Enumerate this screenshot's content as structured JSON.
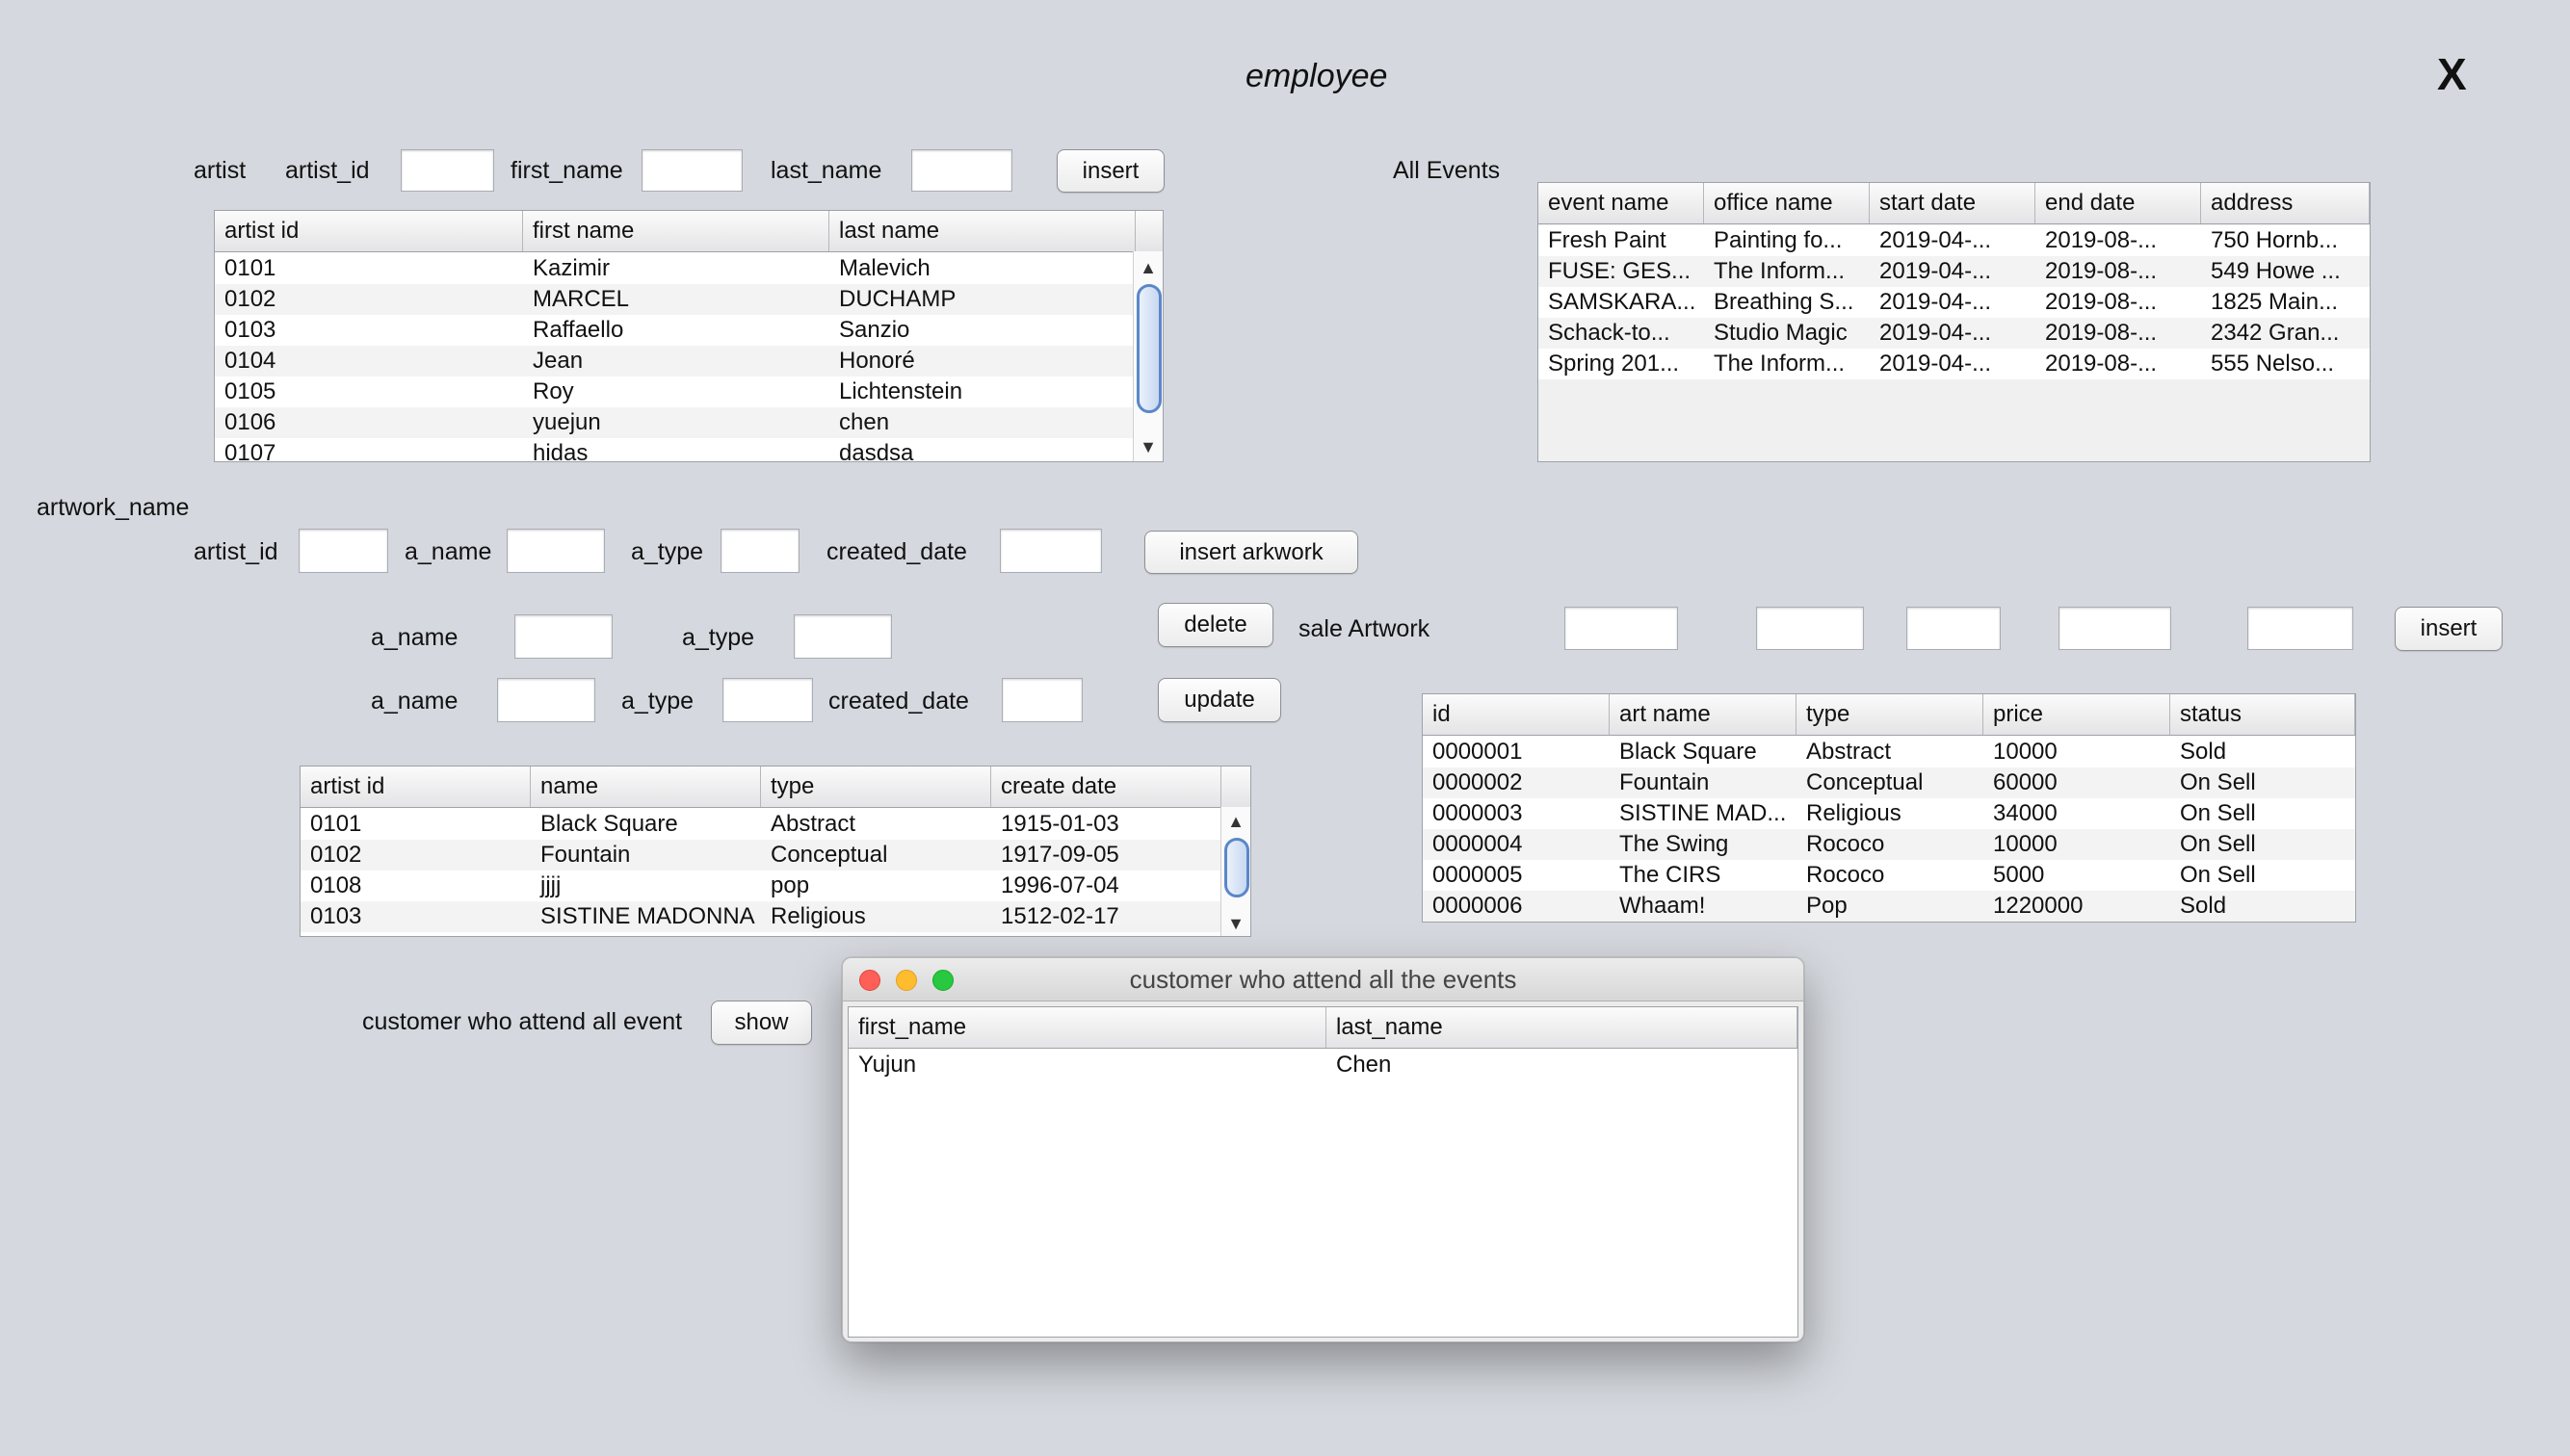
{
  "window": {
    "title": "employee",
    "close_label": "X"
  },
  "artist": {
    "section_label": "artist",
    "id_label": "artist_id",
    "first_label": "first_name",
    "last_label": "last_name",
    "id_value": "",
    "first_value": "",
    "last_value": "",
    "insert_label": "insert",
    "table": {
      "columns": [
        "artist id",
        "first name",
        "last name"
      ],
      "rows": [
        [
          "0101",
          "Kazimir",
          "Malevich"
        ],
        [
          "0102",
          "MARCEL",
          "DUCHAMP"
        ],
        [
          "0103",
          "Raffaello",
          "Sanzio"
        ],
        [
          "0104",
          "Jean",
          "Honoré"
        ],
        [
          "0105",
          "Roy",
          "Lichtenstein"
        ],
        [
          "0106",
          "yuejun",
          "chen"
        ],
        [
          "0107",
          "hidas",
          "dasdsa"
        ]
      ]
    }
  },
  "events": {
    "label": "All Events",
    "columns": [
      "event name",
      "office name",
      "start date",
      "end date",
      "address"
    ],
    "rows": [
      [
        "Fresh Paint",
        "Painting fo...",
        "2019-04-...",
        "2019-08-...",
        "750 Hornb..."
      ],
      [
        "FUSE: GES...",
        "The Inform...",
        "2019-04-...",
        "2019-08-...",
        "549 Howe ..."
      ],
      [
        "SAMSKARA...",
        "Breathing S...",
        "2019-04-...",
        "2019-08-...",
        "1825 Main..."
      ],
      [
        "Schack-to...",
        "Studio Magic",
        "2019-04-...",
        "2019-08-...",
        "2342 Gran..."
      ],
      [
        "Spring 201...",
        "The Inform...",
        "2019-04-...",
        "2019-08-...",
        "555 Nelso..."
      ]
    ]
  },
  "artwork": {
    "section_label": "artwork_name",
    "insert_row": {
      "artist_id_label": "artist_id",
      "name_label": "a_name",
      "type_label": "a_type",
      "date_label": "created_date",
      "artist_id_value": "",
      "name_value": "",
      "type_value": "",
      "date_value": "",
      "button_label": "insert arkwork"
    },
    "delete_row": {
      "name_label": "a_name",
      "type_label": "a_type",
      "name_value": "",
      "type_value": "",
      "button_label": "delete"
    },
    "update_row": {
      "name_label": "a_name",
      "type_label": "a_type",
      "date_label": "created_date",
      "name_value": "",
      "type_value": "",
      "date_value": "",
      "button_label": "update"
    },
    "table": {
      "columns": [
        "artist id",
        "name",
        "type",
        "create date"
      ],
      "rows": [
        [
          "0101",
          "Black Square",
          "Abstract",
          "1915-01-03"
        ],
        [
          "0102",
          "Fountain",
          "Conceptual",
          "1917-09-05"
        ],
        [
          "0108",
          "jjjj",
          "pop",
          "1996-07-04"
        ],
        [
          "0103",
          "SISTINE MADONNA",
          "Religious",
          "1512-02-17"
        ]
      ]
    }
  },
  "sale": {
    "label": "sale Artwork",
    "fields": [
      "",
      "",
      "",
      "",
      ""
    ],
    "insert_label": "insert",
    "columns": [
      "id",
      "art name",
      "type",
      "price",
      "status"
    ],
    "rows": [
      [
        "0000001",
        "Black Square",
        "Abstract",
        "10000",
        "Sold"
      ],
      [
        "0000002",
        "Fountain",
        "Conceptual",
        "60000",
        "On Sell"
      ],
      [
        "0000003",
        "SISTINE MAD...",
        "Religious",
        "34000",
        "On Sell"
      ],
      [
        "0000004",
        "The Swing",
        "Rococo",
        "10000",
        "On Sell"
      ],
      [
        "0000005",
        "The CIRS",
        "Rococo",
        "5000",
        "On Sell"
      ],
      [
        "0000006",
        "Whaam!",
        "Pop",
        "1220000",
        "Sold"
      ]
    ]
  },
  "customer": {
    "label": "customer who attend all event",
    "show_label": "show"
  },
  "dialog": {
    "title": "customer who attend all the events",
    "columns": [
      "first_name",
      "last_name"
    ],
    "rows": [
      [
        "Yujun",
        "Chen"
      ]
    ]
  },
  "colors": {
    "background": "#d5d8de",
    "traffic_close": "#fe5f57",
    "traffic_min": "#febc2e",
    "traffic_max": "#28c840",
    "scroll_thumb": "#5a87c8"
  }
}
